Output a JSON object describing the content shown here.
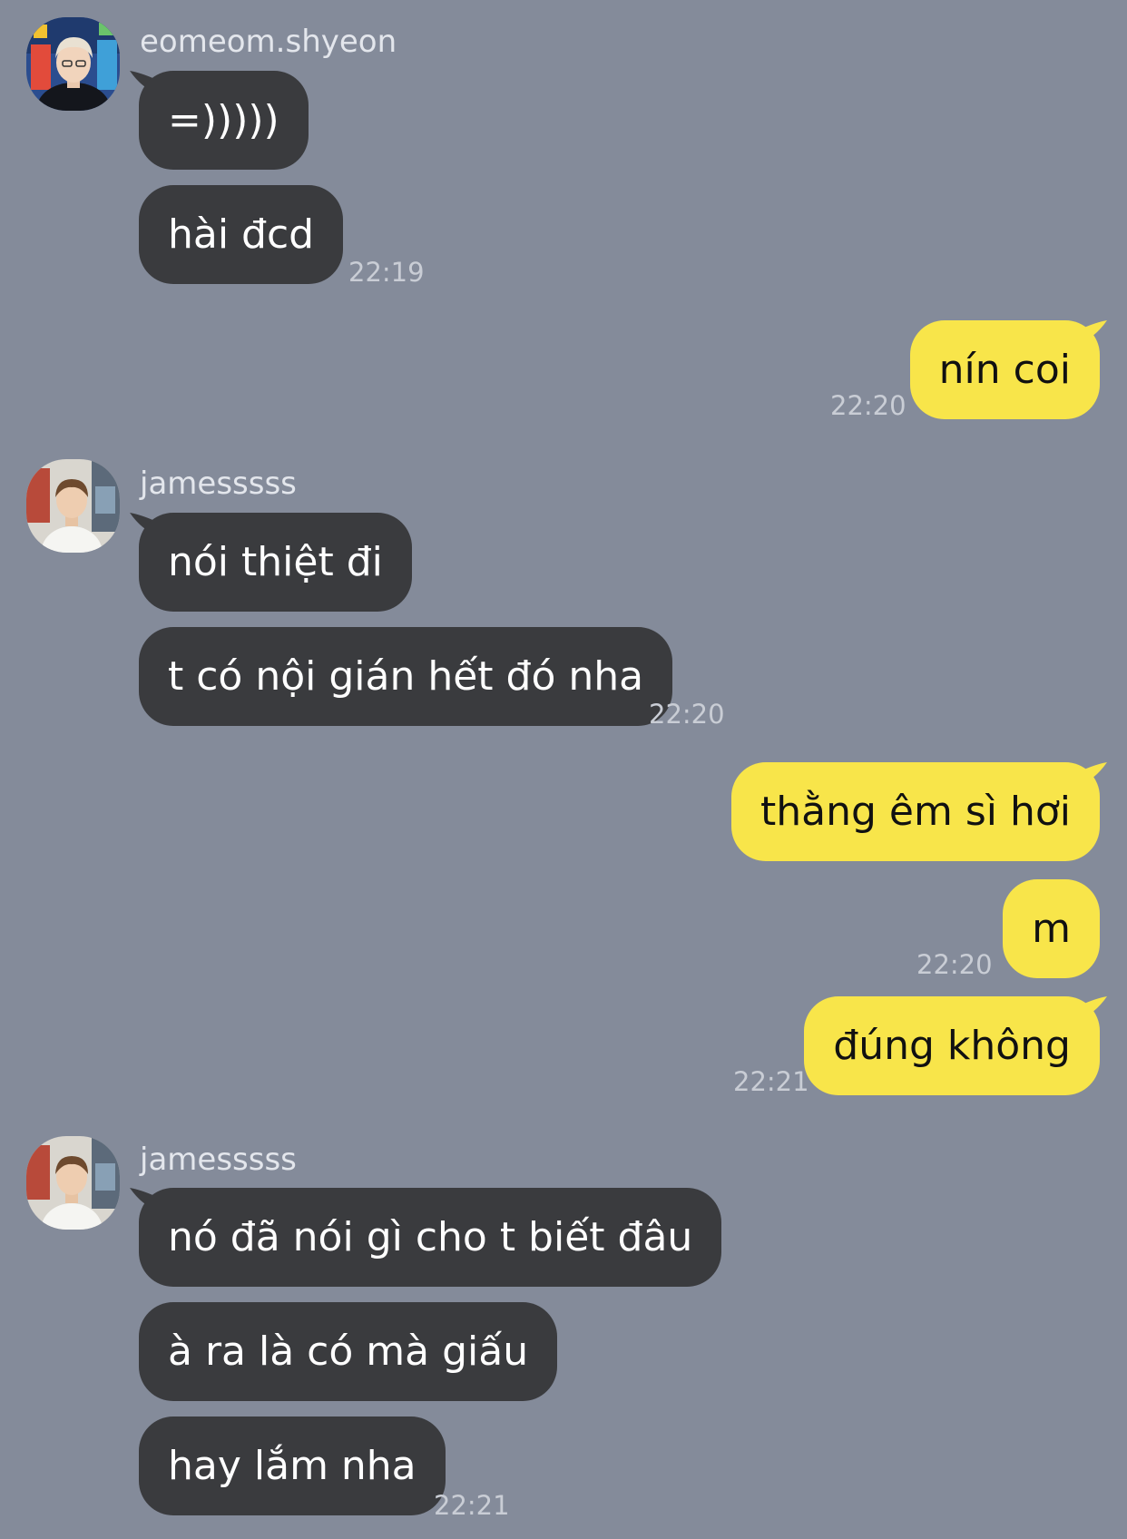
{
  "conversation": {
    "groups": [
      {
        "sender": "eomeom.shyeon",
        "messages": [
          "=)))))",
          "hài đcd"
        ],
        "time": "22:19"
      },
      {
        "me": true,
        "messages": [
          "nín coi"
        ],
        "time": "22:20"
      },
      {
        "sender": "jamesssss",
        "messages": [
          "nói thiệt đi",
          "t có nội gián hết đó nha"
        ],
        "time": "22:20"
      },
      {
        "me": true,
        "messages": [
          "thằng êm sì hơi",
          "m"
        ],
        "time": "22:20"
      },
      {
        "me": true,
        "messages": [
          "đúng không"
        ],
        "time": "22:21"
      },
      {
        "sender": "jamesssss",
        "messages": [
          "nó đã nói gì cho t biết đâu",
          "à ra là có mà giấu",
          "hay lắm nha"
        ],
        "time": "22:21"
      }
    ]
  },
  "colors": {
    "background": "#848B9A",
    "incoming_bubble": "#3A3B3E",
    "outgoing_bubble": "#F8E54A"
  }
}
